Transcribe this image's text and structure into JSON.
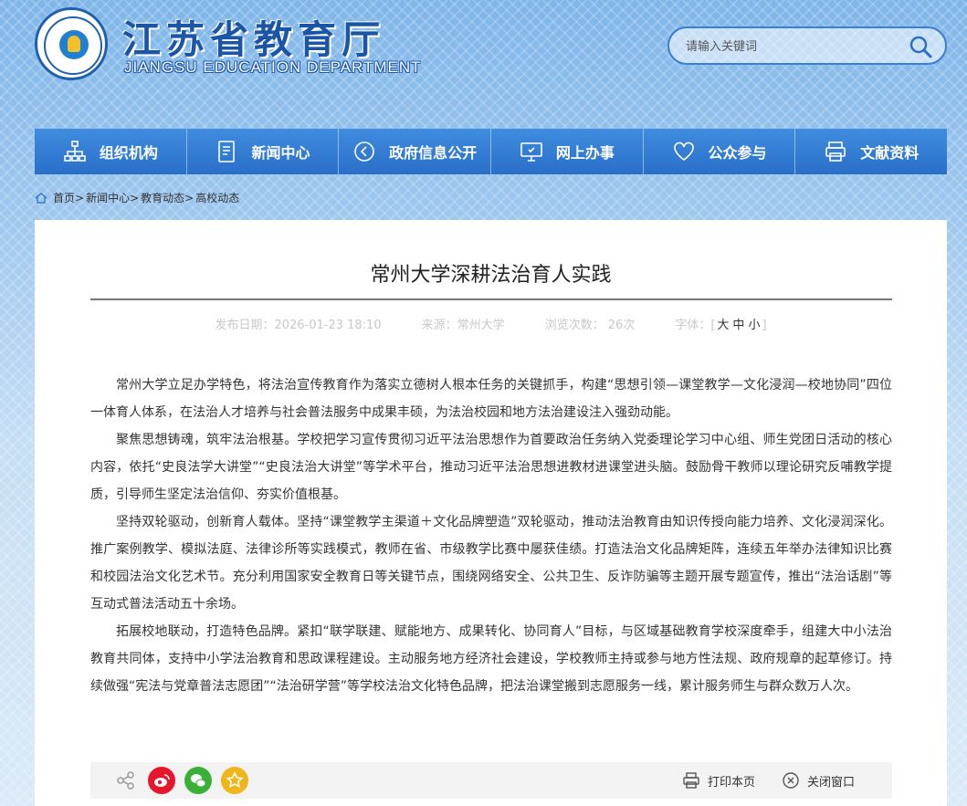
{
  "header": {
    "title_cn": "江苏省教育厅",
    "title_en": "JIANGSU EDUCATION DEPARTMENT",
    "search": {
      "placeholder": "请输入关键词"
    }
  },
  "nav": {
    "items": [
      {
        "label": "组织机构",
        "icon": "org-chart-icon"
      },
      {
        "label": "新闻中心",
        "icon": "news-doc-icon"
      },
      {
        "label": "政府信息公开",
        "icon": "disclosure-icon"
      },
      {
        "label": "网上办事",
        "icon": "monitor-icon"
      },
      {
        "label": "公众参与",
        "icon": "heart-icon"
      },
      {
        "label": "文献资料",
        "icon": "printer-icon"
      }
    ]
  },
  "breadcrumb": [
    "首页>",
    "新闻中心>",
    "教育动态>",
    "高校动态"
  ],
  "article": {
    "title": "常州大学深耕法治育人实践",
    "meta": {
      "date": "发布日期：2026-01-23 18:10",
      "source": "来源：常州大学",
      "views": "浏览次数： 26次",
      "font_label": "字体：",
      "bracket_open": "[",
      "bracket_close": "]",
      "font_large": "大",
      "font_medium": "中",
      "font_small": "小"
    },
    "paragraphs": [
      "常州大学立足办学特色，将法治宣传教育作为落实立德树人根本任务的关键抓手，构建“思想引领—课堂教学—文化浸润—校地协同”四位一体育人体系，在法治人才培养与社会普法服务中成果丰硕，为法治校园和地方法治建设注入强劲动能。",
      "聚焦思想铸魂，筑牢法治根基。学校把学习宣传贯彻习近平法治思想作为首要政治任务纳入党委理论学习中心组、师生党团日活动的核心内容，依托“史良法学大讲堂”“史良法治大讲堂”等学术平台，推动习近平法治思想进教材进课堂进头脑。鼓励骨干教师以理论研究反哺教学提质，引导师生坚定法治信仰、夯实价值根基。",
      "坚持双轮驱动，创新育人载体。坚持“课堂教学主渠道＋文化品牌塑造”双轮驱动，推动法治教育由知识传授向能力培养、文化浸润深化。推广案例教学、模拟法庭、法律诊所等实践模式，教师在省、市级教学比赛中屡获佳绩。打造法治文化品牌矩阵，连续五年举办法律知识比赛和校园法治文化艺术节。充分利用国家安全教育日等关键节点，围绕网络安全、公共卫生、反诈防骗等主题开展专题宣传，推出“法治话剧”等互动式普法活动五十余场。",
      "拓展校地联动，打造特色品牌。紧扣“联学联建、赋能地方、成果转化、协同育人”目标，与区域基础教育学校深度牵手，组建大中小法治教育共同体，支持中小学法治教育和思政课程建设。主动服务地方经济社会建设，学校教师主持或参与地方性法规、政府规章的起草修订。持续做强“宪法与党章普法志愿团”“法治研学营”等学校法治文化特色品牌，把法治课堂搬到志愿服务一线，累计服务师生与群众数万人次。"
    ]
  },
  "sharebar": {
    "icons": [
      "share-icon",
      "weibo-icon",
      "wechat-icon",
      "favorite-icon"
    ],
    "print_label": "打印本页",
    "close_label": "关闭窗口"
  },
  "colors": {
    "nav_bg": "#2a6fc8",
    "brand_blue": "#1a55a8",
    "weibo": "#e6162d",
    "wechat": "#3bb037",
    "favorite": "#f1b51c"
  }
}
